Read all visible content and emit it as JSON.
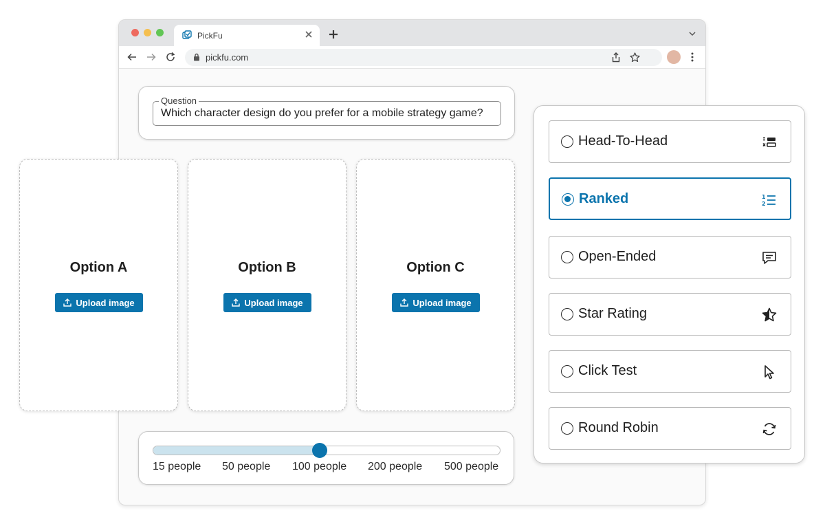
{
  "browser": {
    "tab": {
      "title": "PickFu",
      "icon": "pickfu-logo-icon"
    },
    "address_bar": {
      "url": "pickfu.com"
    }
  },
  "question": {
    "legend": "Question",
    "value": "Which character design do you prefer for a mobile strategy game?"
  },
  "options": [
    {
      "title": "Option A",
      "upload_label": "Upload image"
    },
    {
      "title": "Option B",
      "upload_label": "Upload image"
    },
    {
      "title": "Option C",
      "upload_label": "Upload image"
    }
  ],
  "audience_slider": {
    "labels": [
      "15 people",
      "50 people",
      "100 people",
      "200 people",
      "500 people"
    ],
    "selected": "100 people",
    "selected_index": 2
  },
  "question_types": [
    {
      "label": "Head-To-Head",
      "icon": "head-to-head-icon",
      "selected": false
    },
    {
      "label": "Ranked",
      "icon": "ranked-list-icon",
      "selected": true
    },
    {
      "label": "Open-Ended",
      "icon": "comment-icon",
      "selected": false
    },
    {
      "label": "Star Rating",
      "icon": "star-icon",
      "selected": false
    },
    {
      "label": "Click Test",
      "icon": "cursor-icon",
      "selected": false
    },
    {
      "label": "Round Robin",
      "icon": "refresh-icon",
      "selected": false
    }
  ],
  "colors": {
    "accent": "#0b74ad",
    "slider_fill": "#cbe3ee"
  }
}
